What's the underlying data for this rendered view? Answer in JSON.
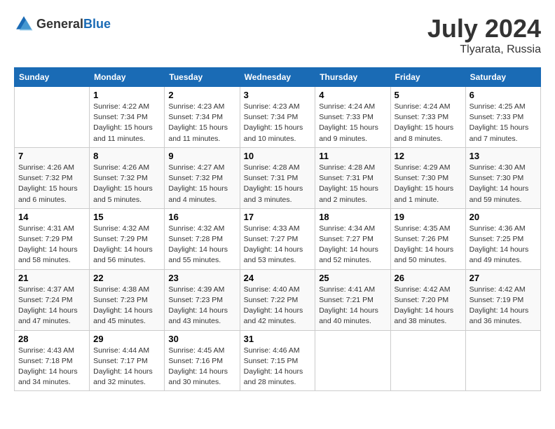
{
  "header": {
    "logo_general": "General",
    "logo_blue": "Blue",
    "title": "July 2024",
    "location": "Tlyarata, Russia"
  },
  "columns": [
    "Sunday",
    "Monday",
    "Tuesday",
    "Wednesday",
    "Thursday",
    "Friday",
    "Saturday"
  ],
  "weeks": [
    {
      "shade": "white",
      "days": [
        {
          "num": "",
          "info": ""
        },
        {
          "num": "1",
          "info": "Sunrise: 4:22 AM\nSunset: 7:34 PM\nDaylight: 15 hours\nand 11 minutes."
        },
        {
          "num": "2",
          "info": "Sunrise: 4:23 AM\nSunset: 7:34 PM\nDaylight: 15 hours\nand 11 minutes."
        },
        {
          "num": "3",
          "info": "Sunrise: 4:23 AM\nSunset: 7:34 PM\nDaylight: 15 hours\nand 10 minutes."
        },
        {
          "num": "4",
          "info": "Sunrise: 4:24 AM\nSunset: 7:33 PM\nDaylight: 15 hours\nand 9 minutes."
        },
        {
          "num": "5",
          "info": "Sunrise: 4:24 AM\nSunset: 7:33 PM\nDaylight: 15 hours\nand 8 minutes."
        },
        {
          "num": "6",
          "info": "Sunrise: 4:25 AM\nSunset: 7:33 PM\nDaylight: 15 hours\nand 7 minutes."
        }
      ]
    },
    {
      "shade": "shade",
      "days": [
        {
          "num": "7",
          "info": "Sunrise: 4:26 AM\nSunset: 7:32 PM\nDaylight: 15 hours\nand 6 minutes."
        },
        {
          "num": "8",
          "info": "Sunrise: 4:26 AM\nSunset: 7:32 PM\nDaylight: 15 hours\nand 5 minutes."
        },
        {
          "num": "9",
          "info": "Sunrise: 4:27 AM\nSunset: 7:32 PM\nDaylight: 15 hours\nand 4 minutes."
        },
        {
          "num": "10",
          "info": "Sunrise: 4:28 AM\nSunset: 7:31 PM\nDaylight: 15 hours\nand 3 minutes."
        },
        {
          "num": "11",
          "info": "Sunrise: 4:28 AM\nSunset: 7:31 PM\nDaylight: 15 hours\nand 2 minutes."
        },
        {
          "num": "12",
          "info": "Sunrise: 4:29 AM\nSunset: 7:30 PM\nDaylight: 15 hours\nand 1 minute."
        },
        {
          "num": "13",
          "info": "Sunrise: 4:30 AM\nSunset: 7:30 PM\nDaylight: 14 hours\nand 59 minutes."
        }
      ]
    },
    {
      "shade": "white",
      "days": [
        {
          "num": "14",
          "info": "Sunrise: 4:31 AM\nSunset: 7:29 PM\nDaylight: 14 hours\nand 58 minutes."
        },
        {
          "num": "15",
          "info": "Sunrise: 4:32 AM\nSunset: 7:29 PM\nDaylight: 14 hours\nand 56 minutes."
        },
        {
          "num": "16",
          "info": "Sunrise: 4:32 AM\nSunset: 7:28 PM\nDaylight: 14 hours\nand 55 minutes."
        },
        {
          "num": "17",
          "info": "Sunrise: 4:33 AM\nSunset: 7:27 PM\nDaylight: 14 hours\nand 53 minutes."
        },
        {
          "num": "18",
          "info": "Sunrise: 4:34 AM\nSunset: 7:27 PM\nDaylight: 14 hours\nand 52 minutes."
        },
        {
          "num": "19",
          "info": "Sunrise: 4:35 AM\nSunset: 7:26 PM\nDaylight: 14 hours\nand 50 minutes."
        },
        {
          "num": "20",
          "info": "Sunrise: 4:36 AM\nSunset: 7:25 PM\nDaylight: 14 hours\nand 49 minutes."
        }
      ]
    },
    {
      "shade": "shade",
      "days": [
        {
          "num": "21",
          "info": "Sunrise: 4:37 AM\nSunset: 7:24 PM\nDaylight: 14 hours\nand 47 minutes."
        },
        {
          "num": "22",
          "info": "Sunrise: 4:38 AM\nSunset: 7:23 PM\nDaylight: 14 hours\nand 45 minutes."
        },
        {
          "num": "23",
          "info": "Sunrise: 4:39 AM\nSunset: 7:23 PM\nDaylight: 14 hours\nand 43 minutes."
        },
        {
          "num": "24",
          "info": "Sunrise: 4:40 AM\nSunset: 7:22 PM\nDaylight: 14 hours\nand 42 minutes."
        },
        {
          "num": "25",
          "info": "Sunrise: 4:41 AM\nSunset: 7:21 PM\nDaylight: 14 hours\nand 40 minutes."
        },
        {
          "num": "26",
          "info": "Sunrise: 4:42 AM\nSunset: 7:20 PM\nDaylight: 14 hours\nand 38 minutes."
        },
        {
          "num": "27",
          "info": "Sunrise: 4:42 AM\nSunset: 7:19 PM\nDaylight: 14 hours\nand 36 minutes."
        }
      ]
    },
    {
      "shade": "white",
      "days": [
        {
          "num": "28",
          "info": "Sunrise: 4:43 AM\nSunset: 7:18 PM\nDaylight: 14 hours\nand 34 minutes."
        },
        {
          "num": "29",
          "info": "Sunrise: 4:44 AM\nSunset: 7:17 PM\nDaylight: 14 hours\nand 32 minutes."
        },
        {
          "num": "30",
          "info": "Sunrise: 4:45 AM\nSunset: 7:16 PM\nDaylight: 14 hours\nand 30 minutes."
        },
        {
          "num": "31",
          "info": "Sunrise: 4:46 AM\nSunset: 7:15 PM\nDaylight: 14 hours\nand 28 minutes."
        },
        {
          "num": "",
          "info": ""
        },
        {
          "num": "",
          "info": ""
        },
        {
          "num": "",
          "info": ""
        }
      ]
    }
  ]
}
